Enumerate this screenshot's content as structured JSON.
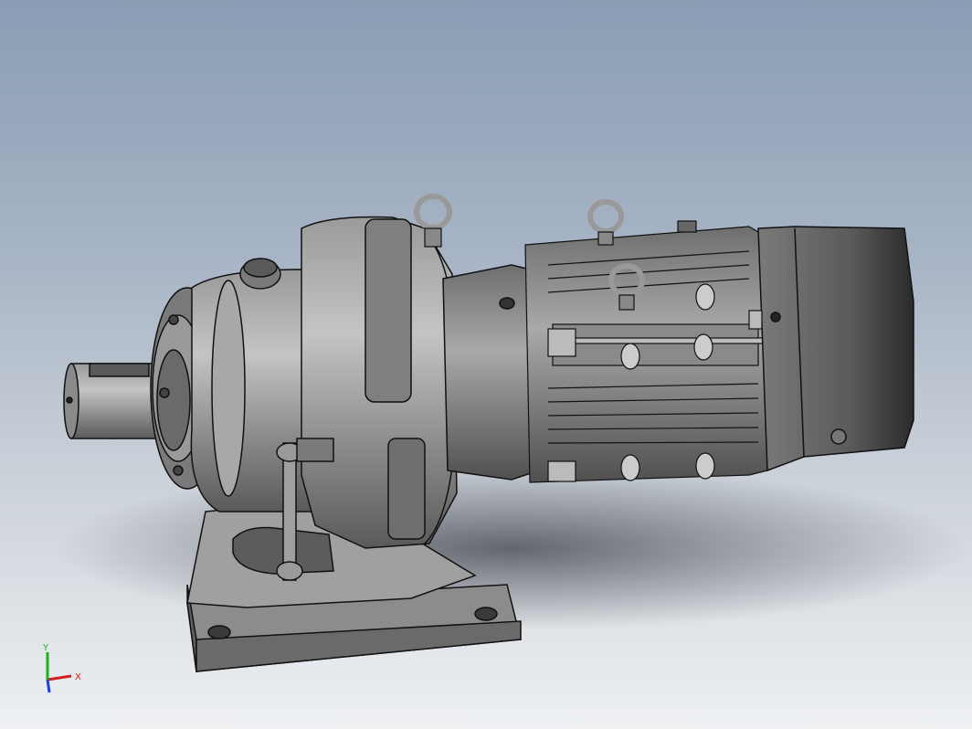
{
  "viewport": {
    "background_top": "#8a9db4",
    "background_bottom": "#eef0f2"
  },
  "model": {
    "shade_light": "#b9b9b9",
    "shade_mid": "#8f8f8f",
    "shade_dark": "#4a4a4a",
    "edge_color": "#111111"
  },
  "triad": {
    "x_label": "X",
    "y_label": "Y",
    "x_color": "#d21f1f",
    "y_color": "#1fb01f",
    "z_color": "#1f3fd2"
  }
}
